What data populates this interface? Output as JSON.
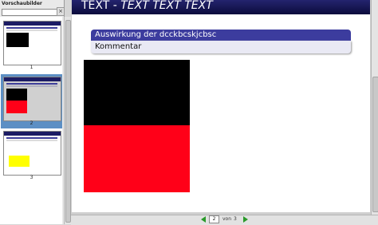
{
  "sidebar": {
    "title": "Vorschaubilder",
    "close": "×",
    "thumbnails": [
      {
        "num": "1",
        "selected": false
      },
      {
        "num": "2",
        "selected": true
      },
      {
        "num": "3",
        "selected": false
      }
    ]
  },
  "slide": {
    "title_normal": "TEXT - ",
    "title_italic": "TEXT TEXT TEXT",
    "block_title": "Auswirkung der dcckbcskjcbsc",
    "block_body": "Kommentar"
  },
  "navigation": {
    "current_page": "2",
    "of_label": "von",
    "total_pages": "3"
  },
  "colors": {
    "title_bar": "#1c1c64",
    "block_head": "#3c3c9e",
    "red": "#ff0018",
    "selected": "#5c8fc4",
    "nav_arrow": "#2a9a2a",
    "thumb_yellow": "#ffff00"
  }
}
